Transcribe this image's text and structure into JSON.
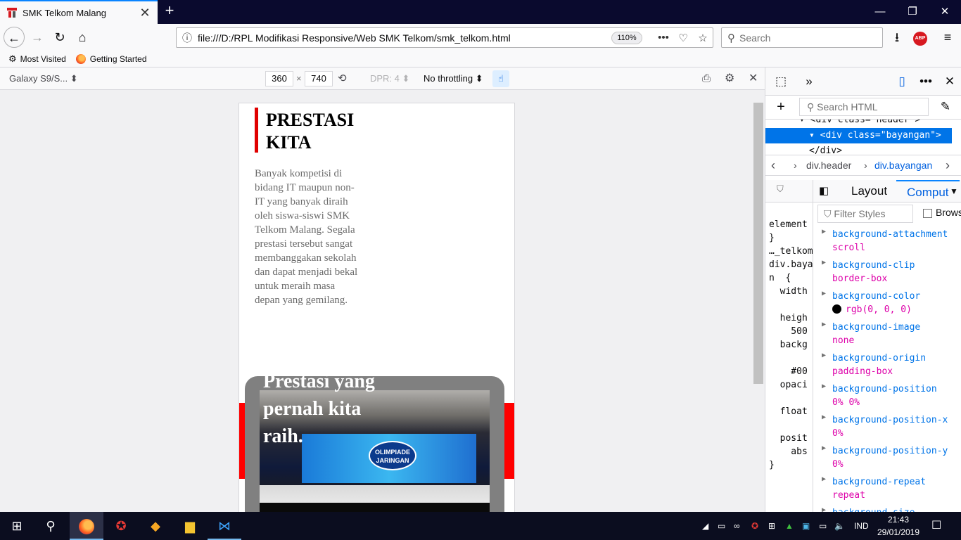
{
  "browser": {
    "tab_title": "SMK Telkom Malang",
    "tab_close": "✕",
    "new_tab": "+",
    "win_min": "—",
    "win_max": "❐",
    "win_close": "✕",
    "url": "file:///D:/RPL Modifikasi Responsive/Web SMK Telkom/smk_telkom.html",
    "zoom": "110%",
    "search_placeholder": "Search",
    "abp_label": "ABP",
    "bookmarks": [
      {
        "label": "Most Visited",
        "icon": "gear-icon"
      },
      {
        "label": "Getting Started",
        "icon": "firefox-icon"
      }
    ]
  },
  "rdm": {
    "device": "Galaxy S9/S...",
    "width": "360",
    "times": "×",
    "height": "740",
    "dpr": "DPR: 4",
    "throttling": "No throttling"
  },
  "page": {
    "title": "PRESTASI KITA",
    "description": "Banyak kompetisi di bidang IT maupun non-IT yang banyak diraih oleh siswa-siswi SMK Telkom Malang. Segala prestasi tersebut sangat membanggakan sekolah dan dapat menjadi bekal untuk meraih masa depan yang gemilang.",
    "overlay": "Prestasi yang pernah kita raih.",
    "screen_logo": "OLIMPIADE JARINGAN"
  },
  "devtools": {
    "search_placeholder": "Search HTML",
    "markup": [
      {
        "text": "<div class=\"header\">",
        "selected": false
      },
      {
        "text": "<div class=\"bayangan\">",
        "selected": true
      },
      {
        "text": "</div>",
        "selected": false
      }
    ],
    "breadcrumbs": [
      "div.header",
      "div.bayangan"
    ],
    "tabs": {
      "layout": "Layout",
      "computed": "Comput"
    },
    "filter_placeholder": "Filter Styles",
    "browser_styles": "Brows",
    "rules_lines": [
      "element",
      "}",
      "…_telkom",
      "div.baya",
      "n  {",
      "  width",
      "",
      "  heigh",
      "    500",
      "  backg",
      "",
      "    #00",
      "  opaci",
      "",
      "  float",
      "",
      "  posit",
      "    abs",
      "}"
    ],
    "computed": [
      {
        "name": "background-attachment",
        "value": "scroll"
      },
      {
        "name": "background-clip",
        "value": "border-box"
      },
      {
        "name": "background-color",
        "value": "rgb(0, 0, 0)",
        "swatch": "#000000"
      },
      {
        "name": "background-image",
        "value": "none"
      },
      {
        "name": "background-origin",
        "value": "padding-box"
      },
      {
        "name": "background-position",
        "value": "0% 0%"
      },
      {
        "name": "background-position-x",
        "value": "0%"
      },
      {
        "name": "background-position-y",
        "value": "0%"
      },
      {
        "name": "background-repeat",
        "value": "repeat"
      },
      {
        "name": "background-size",
        "value": ""
      }
    ]
  },
  "taskbar": {
    "language": "IND",
    "time": "21:43",
    "date": "29/01/2019"
  }
}
